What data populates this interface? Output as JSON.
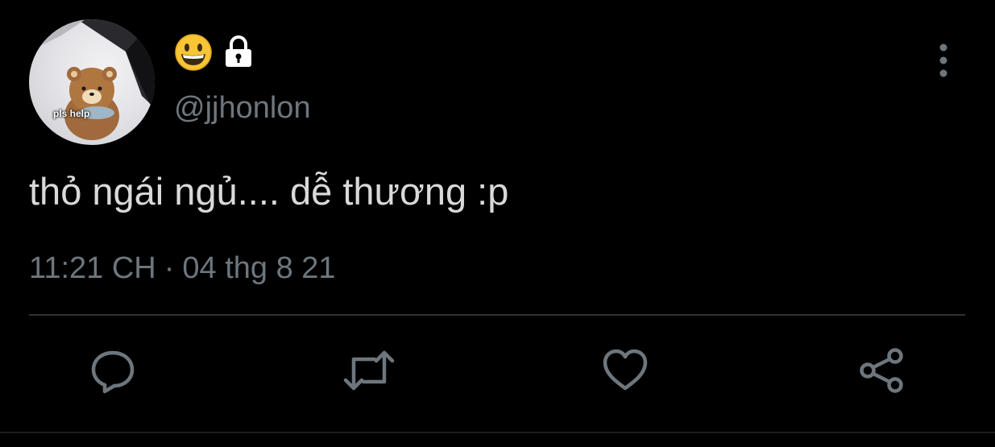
{
  "user": {
    "display_name": "😀🔒",
    "display_emoji": "grinning-face",
    "verified_lock": "lock-icon",
    "handle": "@jjhonlon",
    "avatar_caption": "pls help"
  },
  "tweet": {
    "text": "thỏ ngái ngủ.... dễ thương :p",
    "time": "11:21 CH",
    "separator": "·",
    "date": "04 thg 8 21"
  },
  "actions": [
    {
      "name": "reply",
      "icon": "reply-icon"
    },
    {
      "name": "retweet",
      "icon": "retweet-icon"
    },
    {
      "name": "like",
      "icon": "heart-icon"
    },
    {
      "name": "share",
      "icon": "share-icon"
    }
  ],
  "colors": {
    "background": "#000000",
    "text": "#d9d9d9",
    "muted": "#6e767d",
    "divider": "#2f3336"
  }
}
